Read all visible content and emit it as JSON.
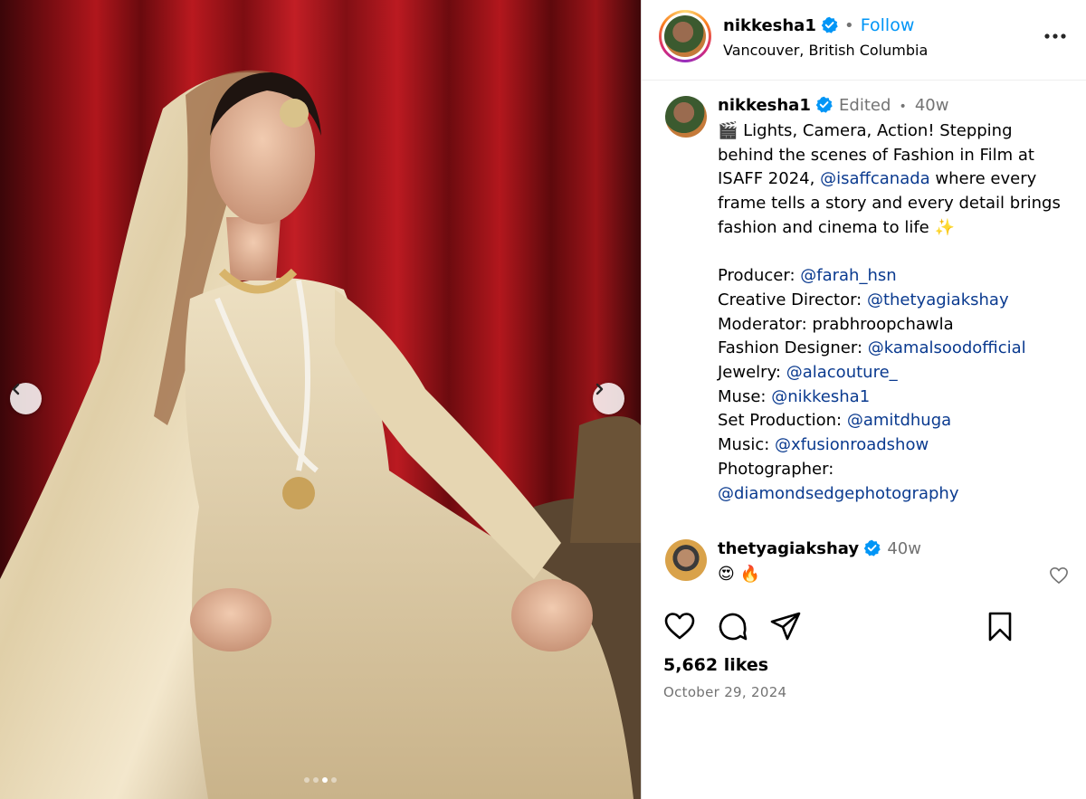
{
  "post": {
    "username": "nikkesha1",
    "follow_label": "Follow",
    "location": "Vancouver, British Columbia",
    "edited_label": "Edited",
    "age": "40w",
    "caption": {
      "emoji_clapper": "🎬",
      "lines": [
        [
          {
            "t": "Lights, Camera, Action! Stepping"
          }
        ],
        [
          {
            "t": "behind the scenes of Fashion in Film at"
          }
        ],
        [
          {
            "t": "ISAFF 2024, "
          },
          {
            "t": "@isaffcanada",
            "link": true
          },
          {
            "t": " where every"
          }
        ],
        [
          {
            "t": "frame tells a story and every detail brings"
          }
        ],
        [
          {
            "t": "fashion and cinema to life "
          },
          {
            "t": "✨"
          }
        ],
        [
          {
            "t": " "
          }
        ],
        [
          {
            "t": "Producer: "
          },
          {
            "t": "@farah_hsn",
            "link": true
          }
        ],
        [
          {
            "t": "Creative Director: "
          },
          {
            "t": "@thetyagiakshay",
            "link": true
          }
        ],
        [
          {
            "t": "Moderator: prabhroopchawla"
          }
        ],
        [
          {
            "t": "Fashion Designer: "
          },
          {
            "t": "@kamalsoodofficial",
            "link": true
          }
        ],
        [
          {
            "t": "Jewelry: "
          },
          {
            "t": "@alacouture_",
            "link": true
          }
        ],
        [
          {
            "t": "Muse: "
          },
          {
            "t": "@nikkesha1",
            "link": true
          }
        ],
        [
          {
            "t": "Set Production: "
          },
          {
            "t": "@amitdhuga",
            "link": true
          }
        ],
        [
          {
            "t": "Music: "
          },
          {
            "t": "@xfusionroadshow",
            "link": true
          }
        ],
        [
          {
            "t": "Photographer:"
          }
        ],
        [
          {
            "t": "@diamondsedgephotography",
            "link": true
          }
        ]
      ]
    },
    "comment": {
      "username": "thetyagiakshay",
      "age": "40w",
      "text": "😍 🔥"
    },
    "likes": "5,662 likes",
    "date": "October 29, 2024",
    "carousel": {
      "count": 4,
      "active_index": 2
    }
  },
  "colors": {
    "accent": "#0095f6",
    "link": "#0a3a8f",
    "secondary_text": "#737373"
  },
  "icons": [
    "verified-badge-icon",
    "more-options-icon",
    "chevron-left-icon",
    "chevron-right-icon",
    "heart-icon",
    "comment-icon",
    "share-icon",
    "bookmark-icon",
    "like-comment-icon"
  ]
}
